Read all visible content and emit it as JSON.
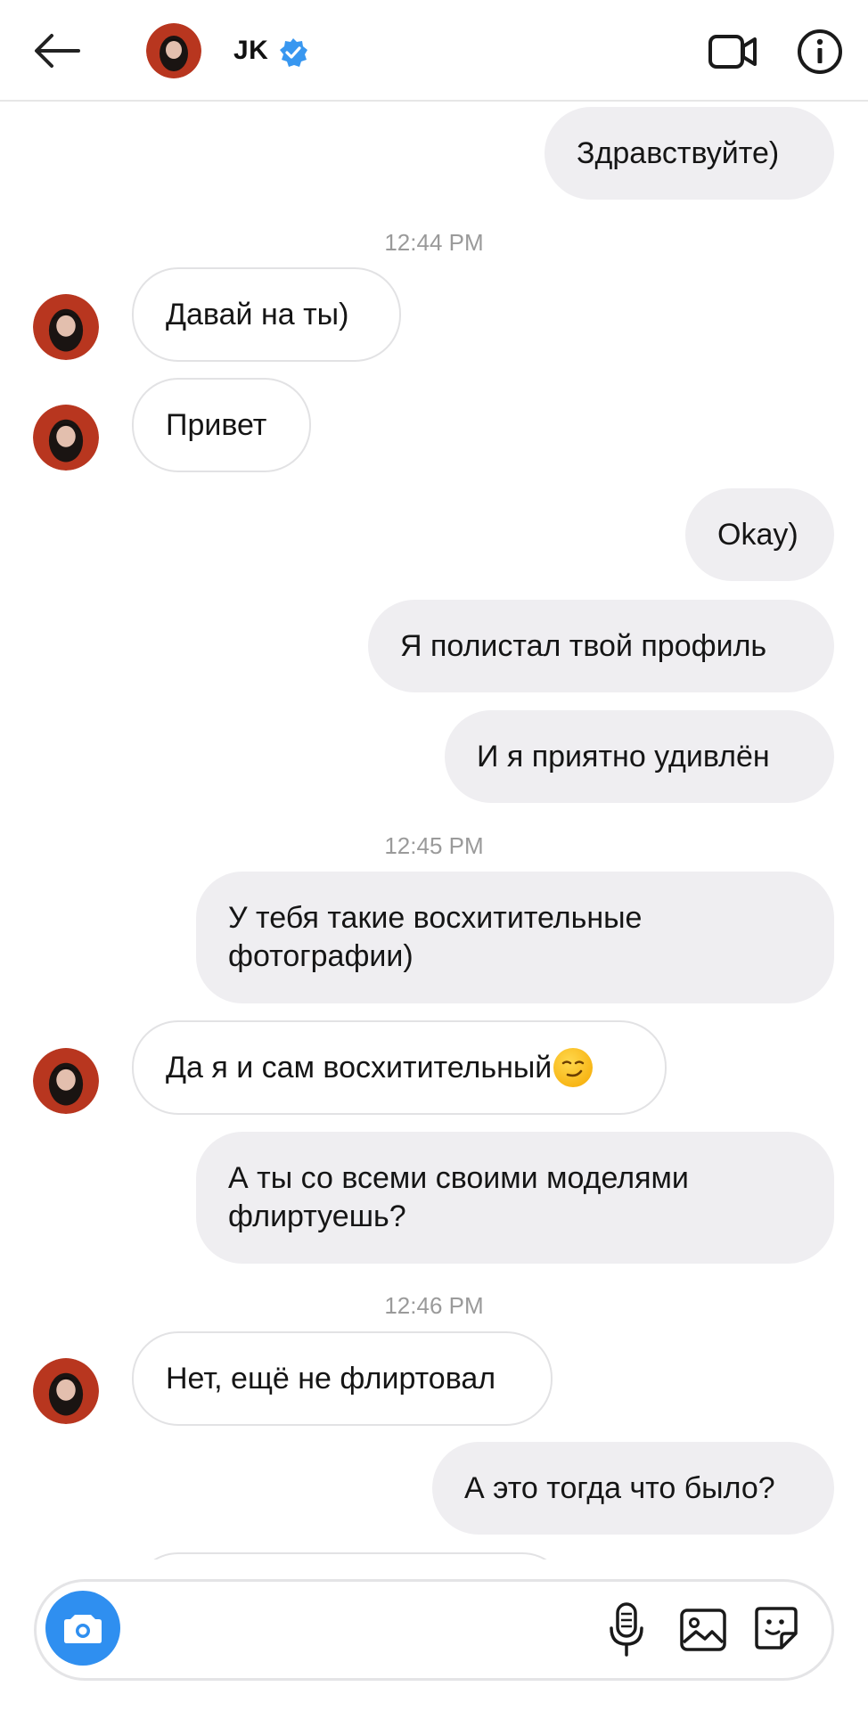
{
  "header": {
    "contact_name": "JK",
    "verified_color": "#3897f0"
  },
  "timestamps": [
    "12:44 PM",
    "12:45 PM",
    "12:46 PM"
  ],
  "messages": [
    {
      "from": "me",
      "text": "Здравствуйте)"
    },
    {
      "from": "them",
      "text": "Давай на ты)"
    },
    {
      "from": "them",
      "text": "Привет"
    },
    {
      "from": "me",
      "text": "Okay)"
    },
    {
      "from": "me",
      "text": "Я полистал твой профиль"
    },
    {
      "from": "me",
      "text": "И я приятно удивлён"
    },
    {
      "from": "me",
      "text": "У тебя такие восхитительные фотографии)"
    },
    {
      "from": "them",
      "text": "Да я и сам восхитительный",
      "emoji": "smirking-face"
    },
    {
      "from": "me",
      "text": "А ты со всеми своими моделями флиртуешь?"
    },
    {
      "from": "them",
      "text": "Нет, ещё не флиртовал"
    },
    {
      "from": "me",
      "text": "А это тогда что было?"
    }
  ],
  "colors": {
    "sent_bubble": "#efeef1",
    "received_border": "#e2e2e4",
    "camera_button": "#2f8ff0",
    "timestamp": "#9a9a9a"
  },
  "icons": {
    "back": "arrow-left-icon",
    "video": "video-camera-icon",
    "info": "info-icon",
    "camera": "camera-icon",
    "mic": "microphone-icon",
    "gallery": "image-icon",
    "sticker": "sticker-icon"
  }
}
